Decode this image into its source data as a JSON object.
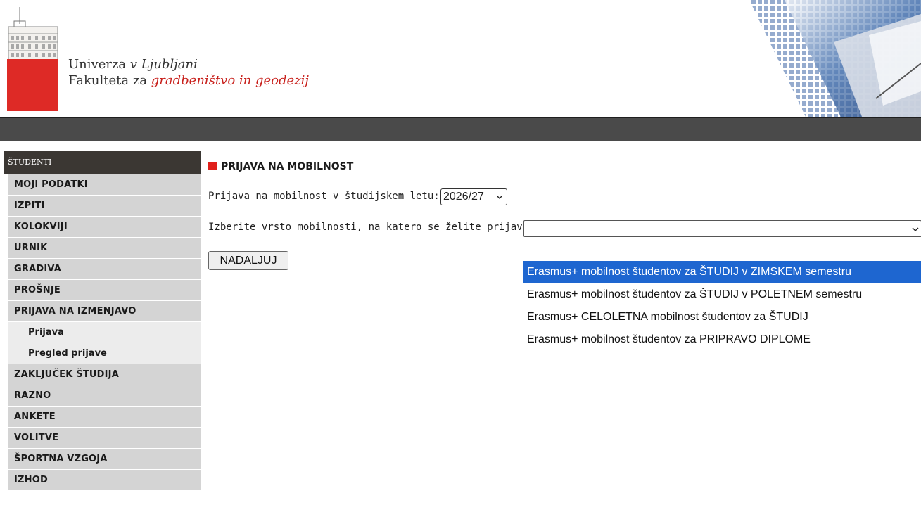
{
  "header": {
    "university_prefix": "Univerza",
    "university_italic": "v Ljubljani",
    "faculty_prefix": "Fakulteta za",
    "faculty_italic": "gradbeništvo in geodezij"
  },
  "sidebar": {
    "heading": "ŠTUDENTI",
    "items": [
      {
        "label": "MOJI PODATKI"
      },
      {
        "label": "IZPITI"
      },
      {
        "label": "KOLOKVIJI"
      },
      {
        "label": "URNIK"
      },
      {
        "label": "GRADIVA"
      },
      {
        "label": "PROŠNJE"
      },
      {
        "label": "PRIJAVA NA IZMENJAVO"
      }
    ],
    "subitems": [
      {
        "label": "Prijava"
      },
      {
        "label": "Pregled prijave"
      }
    ],
    "items_after": [
      {
        "label": "ZAKLJUČEK ŠTUDIJA"
      },
      {
        "label": "RAZNO"
      },
      {
        "label": "ANKETE"
      },
      {
        "label": "VOLITVE"
      },
      {
        "label": "ŠPORTNA VZGOJA"
      },
      {
        "label": "IZHOD"
      }
    ]
  },
  "main": {
    "title": "PRIJAVA NA MOBILNOST",
    "year_label": "Prijava na mobilnost v študijskem letu:",
    "year_value": "2026/27",
    "type_label": "Izberite vrsto mobilnosti, na katero se želite prijaviti:",
    "type_value": "",
    "continue_label": "NADALJUJ",
    "options": [
      "Erasmus+ mobilnost študentov za ŠTUDIJ v ZIMSKEM semestru",
      "Erasmus+ mobilnost študentov za ŠTUDIJ v POLETNEM semestru",
      "Erasmus+ CELOLETNA mobilnost študentov za ŠTUDIJ",
      "Erasmus+ mobilnost študentov za PRIPRAVO DIPLOME"
    ]
  },
  "colors": {
    "accent_red": "#e0201b",
    "selected_option": "#1e66d0",
    "top_bar": "#4a4a4a",
    "sidebar_header": "#3b3733"
  }
}
